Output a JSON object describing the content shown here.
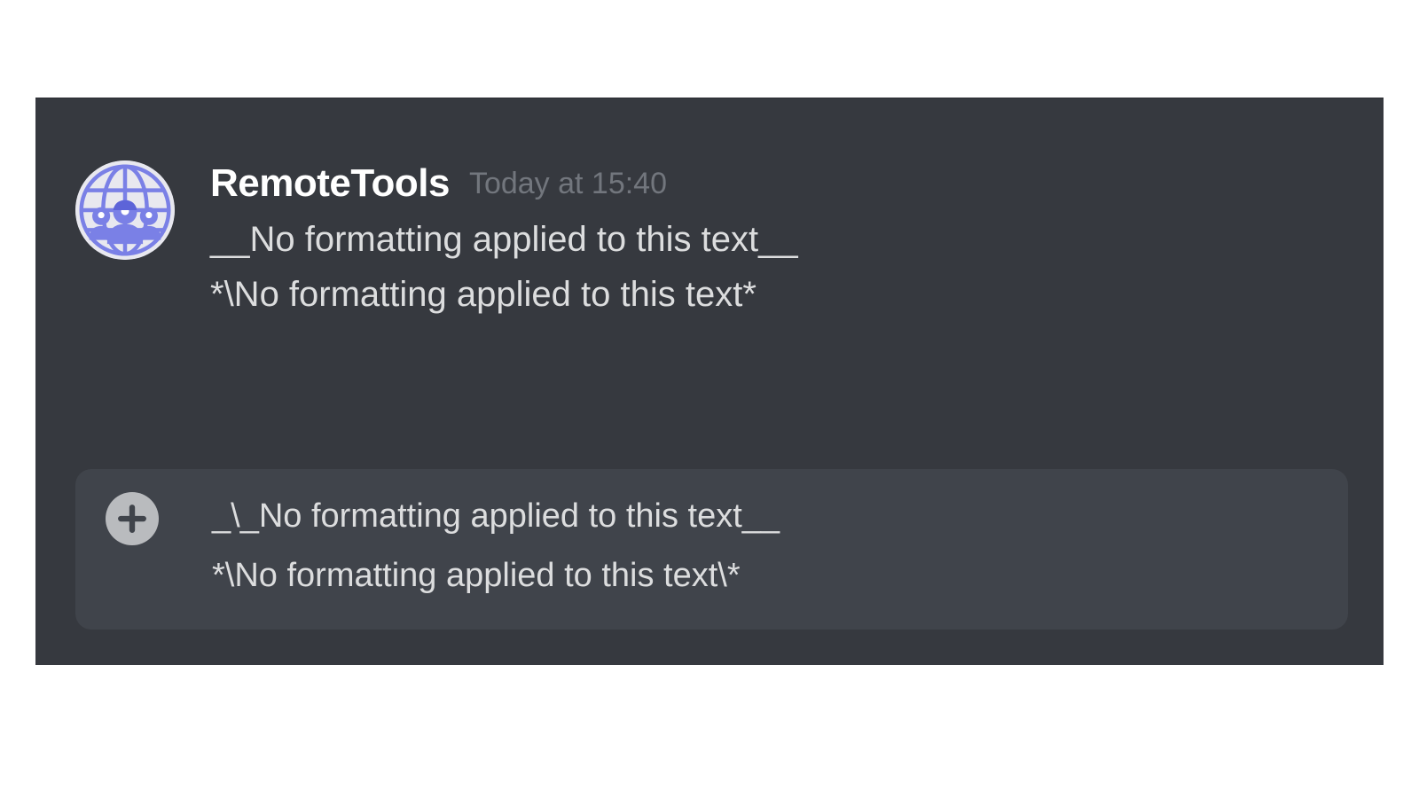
{
  "message": {
    "username": "RemoteTools",
    "timestamp": "Today at 15:40",
    "lines": [
      "__No formatting applied to this text__",
      "*\\No formatting applied to this text*"
    ]
  },
  "input": {
    "lines": [
      "_\\_No formatting applied to this text__",
      "*\\No formatting applied to this text\\*"
    ]
  },
  "colors": {
    "background": "#36393f",
    "input_bg": "#40444b",
    "text_primary": "#dcddde",
    "text_muted": "#72767d",
    "avatar_accent": "#7a80e6"
  }
}
